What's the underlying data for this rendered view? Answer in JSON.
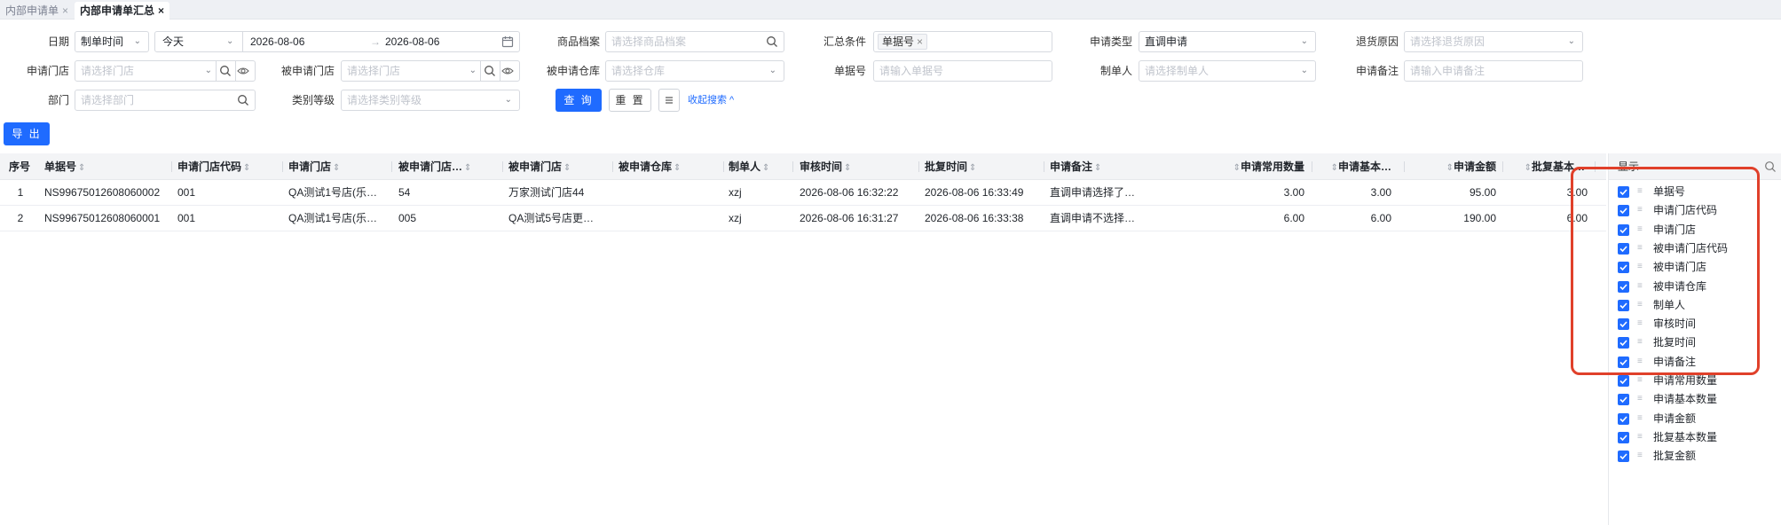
{
  "tabs": [
    {
      "label": "内部申请单",
      "active": false
    },
    {
      "label": "内部申请单汇总",
      "active": true
    }
  ],
  "filters": {
    "date": {
      "label": "日期",
      "type_value": "制单时间",
      "range_value": "今天",
      "start": "2026-08-06",
      "arrow": "→",
      "end": "2026-08-06"
    },
    "product": {
      "label": "商品档案",
      "placeholder": "请选择商品档案"
    },
    "summary": {
      "label": "汇总条件",
      "tag": "单据号"
    },
    "apply_type": {
      "label": "申请类型",
      "value": "直调申请"
    },
    "return_reason": {
      "label": "退货原因",
      "placeholder": "请选择退货原因"
    },
    "apply_store": {
      "label": "申请门店",
      "placeholder": "请选择门店"
    },
    "target_store": {
      "label": "被申请门店",
      "placeholder": "请选择门店"
    },
    "target_warehouse": {
      "label": "被申请仓库",
      "placeholder": "请选择仓库"
    },
    "doc_no": {
      "label": "单据号",
      "placeholder": "请输入单据号"
    },
    "creator": {
      "label": "制单人",
      "placeholder": "请选择制单人"
    },
    "remark": {
      "label": "申请备注",
      "placeholder": "请输入申请备注"
    },
    "department": {
      "label": "部门",
      "placeholder": "请选择部门"
    },
    "category": {
      "label": "类别等级",
      "placeholder": "请选择类别等级"
    },
    "query_label": "查 询",
    "reset_label": "重 置",
    "collapse_label": "收起搜索 ^"
  },
  "export_label": "导 出",
  "table": {
    "columns": [
      "序号",
      "单据号",
      "申请门店代码",
      "申请门店",
      "被申请门店…",
      "被申请门店",
      "被申请仓库",
      "制单人",
      "审核时间",
      "批复时间",
      "申请备注",
      "申请常用数量",
      "申请基本…",
      "申请金额",
      "批复基本…"
    ],
    "rows": [
      [
        "1",
        "NS99675012608060002",
        "001",
        "QA测试1号店(乐…",
        "54",
        "万家测试门店44",
        "",
        "xzj",
        "2026-08-06 16:32:22",
        "2026-08-06 16:33:49",
        "直调申请选择了…",
        "3.00",
        "3.00",
        "95.00",
        "3.00"
      ],
      [
        "2",
        "NS99675012608060001",
        "001",
        "QA测试1号店(乐…",
        "005",
        "QA测试5号店更…",
        "",
        "xzj",
        "2026-08-06 16:31:27",
        "2026-08-06 16:33:38",
        "直调申请不选择…",
        "6.00",
        "6.00",
        "190.00",
        "6.00"
      ]
    ]
  },
  "column_panel": {
    "title": "显示",
    "items": [
      "单据号",
      "申请门店代码",
      "申请门店",
      "被申请门店代码",
      "被申请门店",
      "被申请仓库",
      "制单人",
      "审核时间",
      "批复时间",
      "申请备注",
      "申请常用数量",
      "申请基本数量",
      "申请金额",
      "批复基本数量",
      "批复金额"
    ],
    "checked": [
      true,
      true,
      true,
      true,
      true,
      true,
      true,
      true,
      true,
      true,
      true,
      true,
      true,
      true,
      true
    ]
  },
  "colors": {
    "primary": "#1f6bff",
    "highlight": "#e0402a"
  }
}
